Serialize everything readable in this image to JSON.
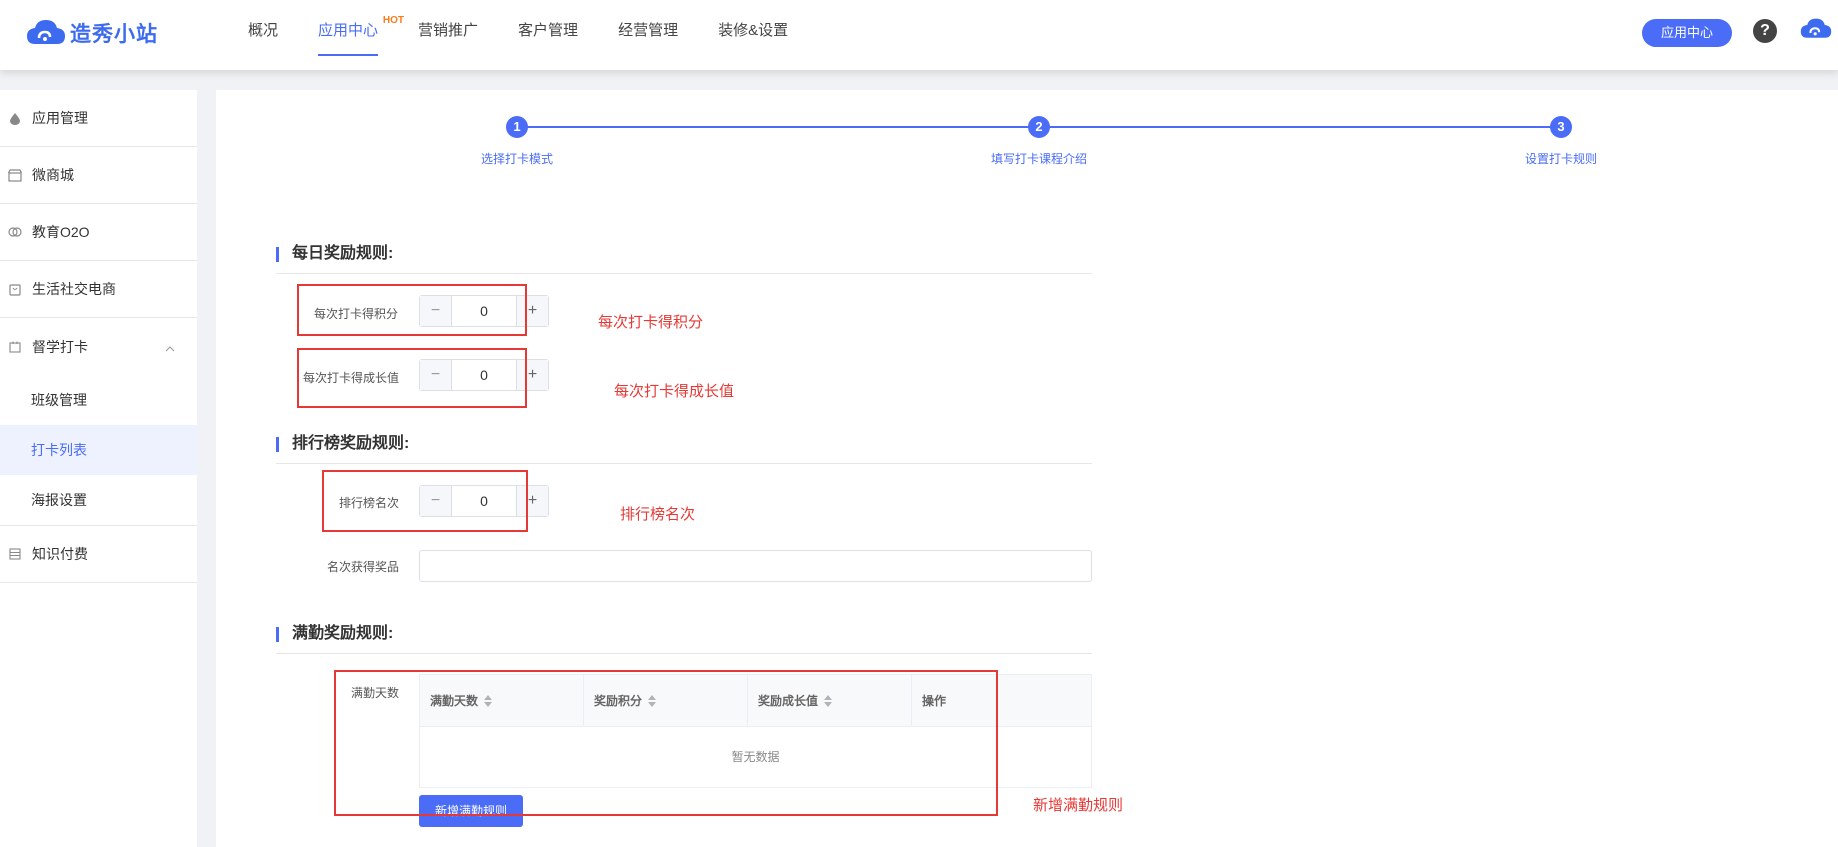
{
  "header": {
    "logo_text": "造秀小站",
    "nav": [
      {
        "label": "概况"
      },
      {
        "label": "应用中心",
        "badge": "HOT",
        "active": true
      },
      {
        "label": "营销推广"
      },
      {
        "label": "客户管理"
      },
      {
        "label": "经营管理"
      },
      {
        "label": "装修&设置"
      }
    ],
    "app_center_button": "应用中心",
    "help_icon": "?"
  },
  "sidebar": {
    "items": [
      {
        "label": "应用管理",
        "icon": "drop-icon"
      },
      {
        "label": "微商城",
        "icon": "store-icon"
      },
      {
        "label": "教育O2O",
        "icon": "education-icon"
      },
      {
        "label": "生活社交电商",
        "icon": "bag-icon"
      },
      {
        "label": "督学打卡",
        "icon": "calendar-icon",
        "expanded": true,
        "children": [
          "班级管理",
          "打卡列表",
          "海报设置"
        ],
        "active_child": "打卡列表"
      },
      {
        "label": "知识付费",
        "icon": "list-icon"
      }
    ]
  },
  "steps": [
    {
      "number": "1",
      "label": "选择打卡模式"
    },
    {
      "number": "2",
      "label": "填写打卡课程介绍"
    },
    {
      "number": "3",
      "label": "设置打卡规则"
    }
  ],
  "daily": {
    "title": "每日奖励规则:",
    "points_label": "每次打卡得积分",
    "points_value": "0",
    "growth_label": "每次打卡得成长值",
    "growth_value": "0"
  },
  "ranking": {
    "title": "排行榜奖励规则:",
    "rank_label": "排行榜名次",
    "rank_value": "0",
    "prize_label": "名次获得奖品",
    "prize_value": ""
  },
  "attendance": {
    "title": "满勤奖励规则:",
    "label": "满勤天数",
    "columns": [
      "满勤天数",
      "奖励积分",
      "奖励成长值",
      "操作"
    ],
    "empty_text": "暂无数据",
    "add_button": "新增满勤规则"
  },
  "annotations": {
    "points": "每次打卡得积分",
    "growth": "每次打卡得成长值",
    "rank": "排行榜名次",
    "add_rule": "新增满勤规则"
  },
  "stepper_symbols": {
    "minus": "−",
    "plus": "+"
  },
  "colors": {
    "accent": "#4a6cf7",
    "annotation": "#e53935",
    "hot": "#ff7a1a"
  }
}
